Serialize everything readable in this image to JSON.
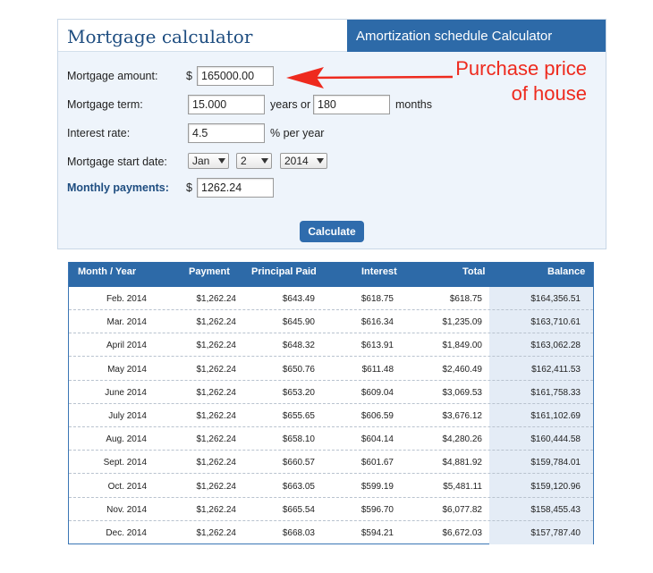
{
  "calculator": {
    "title": "Mortgage calculator",
    "tab_label": "Amortization schedule Calculator",
    "fields": {
      "amount_label": "Mortgage amount:",
      "currency_symbol": "$",
      "amount_value": "165000.00",
      "term_label": "Mortgage term:",
      "term_years_value": "15.000",
      "years_or_text": "years or",
      "term_months_value": "180",
      "months_text": "months",
      "rate_label": "Interest rate:",
      "rate_value": "4.5",
      "rate_suffix": "% per year",
      "start_label": "Mortgage start date:",
      "start_month": "Jan",
      "start_day": "2",
      "start_year": "2014",
      "payment_label": "Monthly payments:",
      "payment_currency": "$",
      "payment_value": "1262.24"
    },
    "calculate_label": "Calculate"
  },
  "annotation": {
    "line1": "Purchase price",
    "line2": "of house",
    "color": "#ee2a1e"
  },
  "table": {
    "headers": [
      "Month / Year",
      "Payment",
      "Principal Paid",
      "Interest",
      "Total",
      "Balance"
    ],
    "rows": [
      [
        "Feb. 2014",
        "$1,262.24",
        "$643.49",
        "$618.75",
        "$618.75",
        "$164,356.51"
      ],
      [
        "Mar. 2014",
        "$1,262.24",
        "$645.90",
        "$616.34",
        "$1,235.09",
        "$163,710.61"
      ],
      [
        "April 2014",
        "$1,262.24",
        "$648.32",
        "$613.91",
        "$1,849.00",
        "$163,062.28"
      ],
      [
        "May 2014",
        "$1,262.24",
        "$650.76",
        "$611.48",
        "$2,460.49",
        "$162,411.53"
      ],
      [
        "June 2014",
        "$1,262.24",
        "$653.20",
        "$609.04",
        "$3,069.53",
        "$161,758.33"
      ],
      [
        "July 2014",
        "$1,262.24",
        "$655.65",
        "$606.59",
        "$3,676.12",
        "$161,102.69"
      ],
      [
        "Aug. 2014",
        "$1,262.24",
        "$658.10",
        "$604.14",
        "$4,280.26",
        "$160,444.58"
      ],
      [
        "Sept. 2014",
        "$1,262.24",
        "$660.57",
        "$601.67",
        "$4,881.92",
        "$159,784.01"
      ],
      [
        "Oct. 2014",
        "$1,262.24",
        "$663.05",
        "$599.19",
        "$5,481.11",
        "$159,120.96"
      ],
      [
        "Nov. 2014",
        "$1,262.24",
        "$665.54",
        "$596.70",
        "$6,077.82",
        "$158,455.43"
      ],
      [
        "Dec. 2014",
        "$1,262.24",
        "$668.03",
        "$594.21",
        "$6,672.03",
        "$157,787.40"
      ]
    ]
  },
  "colors": {
    "header_blue": "#2d6aa8",
    "title_blue": "#1e4d80",
    "panel_bg": "#eef4fb"
  }
}
